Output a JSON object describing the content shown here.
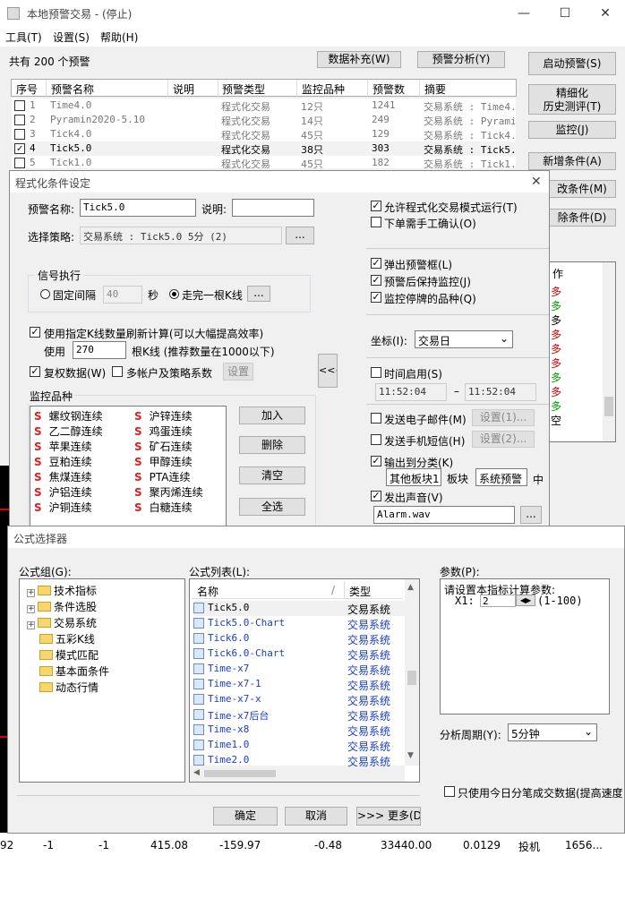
{
  "app": {
    "title": "本地预警交易 - (停止)",
    "min": "—",
    "max": "☐",
    "close": "✕"
  },
  "menu": {
    "tools": "工具(T)",
    "settings": "设置(S)",
    "help": "帮助(H)"
  },
  "main": {
    "total_label": "共有 200 个预警",
    "data_fill_button": "数据补充(W)",
    "alert_analysis_button": "预警分析(Y)",
    "start_alert_button": "启动预警(S)",
    "refine_button_line1": "精细化",
    "refine_button_line2": "历史测评(T)",
    "monitor_button": "监控(J)",
    "add_condition_button": "新增条件(A)",
    "modify_condition_button": "改条件(M)",
    "delete_condition_button": "除条件(D)",
    "columns": [
      "序号",
      "预警名称",
      "说明",
      "预警类型",
      "监控品种",
      "预警数",
      "摘要"
    ],
    "rows": [
      {
        "idx": "1",
        "name": "Time4.0",
        "type": "程式化交易",
        "var": "12只",
        "count": "1241",
        "summary": "交易系统 : Time4.",
        "checked": false
      },
      {
        "idx": "2",
        "name": "Pyramin2020-5.10",
        "type": "程式化交易",
        "var": "14只",
        "count": "249",
        "summary": "交易系统 : Pyrami",
        "checked": false
      },
      {
        "idx": "3",
        "name": "Tick4.0",
        "type": "程式化交易",
        "var": "45只",
        "count": "129",
        "summary": "交易系统 : Tick4.",
        "checked": false
      },
      {
        "idx": "4",
        "name": "Tick5.0",
        "type": "程式化交易",
        "var": "38只",
        "count": "303",
        "summary": "交易系统 : Tick5.",
        "checked": true
      },
      {
        "idx": "5",
        "name": "Tick1.0",
        "type": "程式化交易",
        "var": "45只",
        "count": "182",
        "summary": "交易系统 : Tick1.",
        "checked": false
      }
    ],
    "side_header": "作",
    "side_items": [
      "多",
      "多",
      "多",
      "多",
      "多",
      "多",
      "多",
      "多",
      "多",
      "多",
      "空"
    ]
  },
  "cond_dialog": {
    "title": "程式化条件设定",
    "alert_name_label": "预警名称:",
    "alert_name_value": "Tick5.0",
    "desc_label": "说明:",
    "desc_value": "",
    "strategy_label": "选择策略:",
    "strategy_value": "交易系统 : Tick5.0 5分 (2)",
    "browse": "...",
    "signal_group": "信号执行",
    "fixed_interval": "固定间隔",
    "interval_value": "40",
    "seconds": "秒",
    "bar_complete": "走完一根K线",
    "use_kline_label": "使用指定K线数量刷新计算(可以大幅提高效率)",
    "use_label": "使用",
    "kline_count": "270",
    "kline_hint": "根K线 (推荐数量在1000以下)",
    "adjust_data": "复权数据(W)",
    "multi_account": "多帐户及策略系数",
    "settings_button": "设置",
    "monitor_group": "监控品种",
    "monitor_items": [
      "螺纹钢连续",
      "沪锌连续",
      "乙二醇连续",
      "鸡蛋连续",
      "苹果连续",
      "矿石连续",
      "豆粕连续",
      "甲醇连续",
      "焦煤连续",
      "PTA连续",
      "沪铝连续",
      "聚丙烯连续",
      "沪铜连续",
      "白糖连续"
    ],
    "monitor_prefix": "S",
    "add_button": "加入",
    "remove_button": "删除",
    "clear_button": "清空",
    "select_all_button": "全选",
    "collapse_button": "<<<",
    "allow_auto_trade": "允许程式化交易模式运行(T)",
    "manual_confirm": "下单需手工确认(O)",
    "popup_alert": "弹出预警框(L)",
    "keep_monitor": "预警后保持监控(J)",
    "monitor_suspended": "监控停牌的品种(Q)",
    "coord_label": "坐标(I):",
    "coord_value": "交易日",
    "time_enable": "时间启用(S)",
    "time_start": "11:52:04",
    "time_dash": "–",
    "time_end": "11:52:04",
    "send_email": "发送电子邮件(M)",
    "email_settings": "设置(1)...",
    "send_sms": "发送手机短信(H)",
    "sms_settings": "设置(2)...",
    "output_category": "输出到分类(K)",
    "other_sector": "其他板块1",
    "sector_label": "板块",
    "system_alert": "系统预警",
    "middle_label": "中",
    "play_sound": "发出声音(V)",
    "sound_file": "Alarm.wav",
    "close": "✕"
  },
  "formula_dialog": {
    "title": "公式选择器",
    "group_label": "公式组(G):",
    "tree": [
      {
        "label": "技术指标",
        "expander": "+"
      },
      {
        "label": "条件选股",
        "expander": "+"
      },
      {
        "label": "交易系统",
        "expander": "+"
      },
      {
        "label": "五彩K线",
        "expander": ""
      },
      {
        "label": "模式匹配",
        "expander": ""
      },
      {
        "label": "基本面条件",
        "expander": ""
      },
      {
        "label": "动态行情",
        "expander": ""
      }
    ],
    "list_label": "公式列表(L):",
    "col_name": "名称",
    "col_sort": "/",
    "col_type": "类型",
    "formulas": [
      {
        "name": "Tick5.0",
        "type": "交易系统"
      },
      {
        "name": "Tick5.0-Chart",
        "type": "交易系统"
      },
      {
        "name": "Tick6.0",
        "type": "交易系统"
      },
      {
        "name": "Tick6.0-Chart",
        "type": "交易系统"
      },
      {
        "name": "Time-x7",
        "type": "交易系统"
      },
      {
        "name": "Time-x7-1",
        "type": "交易系统"
      },
      {
        "name": "Time-x7-x",
        "type": "交易系统"
      },
      {
        "name": "Time-x7后台",
        "type": "交易系统"
      },
      {
        "name": "Time-x8",
        "type": "交易系统"
      },
      {
        "name": "Time1.0",
        "type": "交易系统"
      },
      {
        "name": "Time2.0",
        "type": "交易系统"
      }
    ],
    "params_label": "参数(P):",
    "params_hint": "请设置本指标计算参数:",
    "param_name": "X1:",
    "param_value": "2",
    "param_range": "(1-100)",
    "period_label": "分析周期(Y):",
    "period_value": "5分钟",
    "use_today_tick": "只使用今日分笔成交数据(提高速度",
    "ok_button": "确定",
    "cancel_button": "取消",
    "more_button": ">>> 更多(D)"
  },
  "bottom_row": [
    "92",
    "-1",
    "-1",
    "415.08",
    "-159.97",
    "-0.48",
    "33440.00",
    "0.0129",
    "投机",
    "1656..."
  ],
  "colors": {
    "accent_red": "#e02020",
    "formula_blue": "#1a3cc8",
    "dialog_bg": "#f0f0f0"
  }
}
